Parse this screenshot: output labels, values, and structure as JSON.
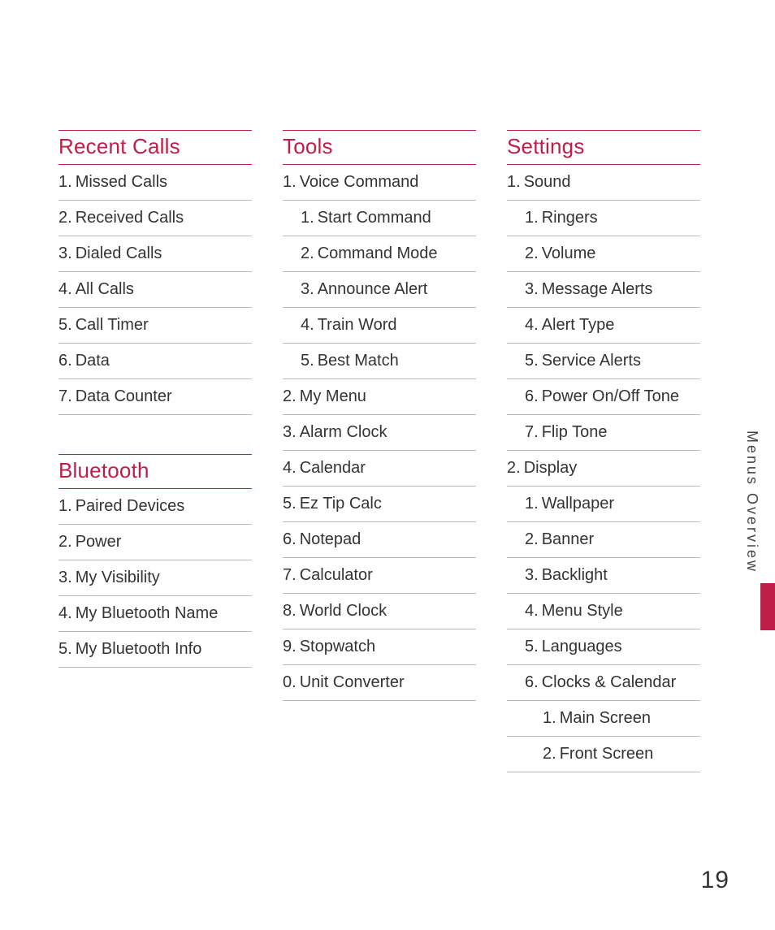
{
  "sideTab": "Menus Overview",
  "pageNumber": "19",
  "columns": [
    {
      "sections": [
        {
          "title": "Recent Calls",
          "items": [
            {
              "num": "1.",
              "label": "Missed Calls",
              "indent": 0
            },
            {
              "num": "2.",
              "label": "Received Calls",
              "indent": 0
            },
            {
              "num": "3.",
              "label": "Dialed Calls",
              "indent": 0
            },
            {
              "num": "4.",
              "label": "All Calls",
              "indent": 0
            },
            {
              "num": "5.",
              "label": "Call Timer",
              "indent": 0
            },
            {
              "num": "6.",
              "label": "Data",
              "indent": 0
            },
            {
              "num": "7.",
              "label": "Data Counter",
              "indent": 0
            }
          ]
        },
        {
          "title": "Bluetooth",
          "items": [
            {
              "num": "1.",
              "label": "Paired Devices",
              "indent": 0
            },
            {
              "num": "2.",
              "label": "Power",
              "indent": 0
            },
            {
              "num": "3.",
              "label": "My Visibility",
              "indent": 0
            },
            {
              "num": "4.",
              "label": "My Bluetooth Name",
              "indent": 0
            },
            {
              "num": "5.",
              "label": "My Bluetooth Info",
              "indent": 0
            }
          ]
        }
      ]
    },
    {
      "sections": [
        {
          "title": "Tools",
          "items": [
            {
              "num": "1.",
              "label": "Voice Command",
              "indent": 0
            },
            {
              "num": "1.",
              "label": "Start Command",
              "indent": 1
            },
            {
              "num": "2.",
              "label": "Command Mode",
              "indent": 1
            },
            {
              "num": "3.",
              "label": "Announce Alert",
              "indent": 1
            },
            {
              "num": "4.",
              "label": "Train Word",
              "indent": 1
            },
            {
              "num": "5.",
              "label": "Best Match",
              "indent": 1
            },
            {
              "num": "2.",
              "label": "My Menu",
              "indent": 0
            },
            {
              "num": "3.",
              "label": "Alarm Clock",
              "indent": 0
            },
            {
              "num": "4.",
              "label": "Calendar",
              "indent": 0
            },
            {
              "num": "5.",
              "label": "Ez Tip Calc",
              "indent": 0
            },
            {
              "num": "6.",
              "label": "Notepad",
              "indent": 0
            },
            {
              "num": "7.",
              "label": "Calculator",
              "indent": 0
            },
            {
              "num": "8.",
              "label": "World Clock",
              "indent": 0
            },
            {
              "num": "9.",
              "label": "Stopwatch",
              "indent": 0
            },
            {
              "num": "0.",
              "label": "Unit Converter",
              "indent": 0
            }
          ]
        }
      ]
    },
    {
      "sections": [
        {
          "title": "Settings",
          "items": [
            {
              "num": "1.",
              "label": "Sound",
              "indent": 0
            },
            {
              "num": "1.",
              "label": "Ringers",
              "indent": 1
            },
            {
              "num": "2.",
              "label": "Volume",
              "indent": 1
            },
            {
              "num": "3.",
              "label": "Message Alerts",
              "indent": 1
            },
            {
              "num": "4.",
              "label": "Alert Type",
              "indent": 1
            },
            {
              "num": "5.",
              "label": "Service Alerts",
              "indent": 1
            },
            {
              "num": "6.",
              "label": "Power On/Off Tone",
              "indent": 1
            },
            {
              "num": "7.",
              "label": "Flip Tone",
              "indent": 1
            },
            {
              "num": "2.",
              "label": "Display",
              "indent": 0
            },
            {
              "num": "1.",
              "label": "Wallpaper",
              "indent": 1
            },
            {
              "num": "2.",
              "label": "Banner",
              "indent": 1
            },
            {
              "num": "3.",
              "label": "Backlight",
              "indent": 1
            },
            {
              "num": "4.",
              "label": "Menu Style",
              "indent": 1
            },
            {
              "num": "5.",
              "label": "Languages",
              "indent": 1
            },
            {
              "num": "6.",
              "label": "Clocks & Calendar",
              "indent": 1
            },
            {
              "num": "1.",
              "label": "Main Screen",
              "indent": 2
            },
            {
              "num": "2.",
              "label": "Front Screen",
              "indent": 2
            }
          ]
        }
      ]
    }
  ]
}
